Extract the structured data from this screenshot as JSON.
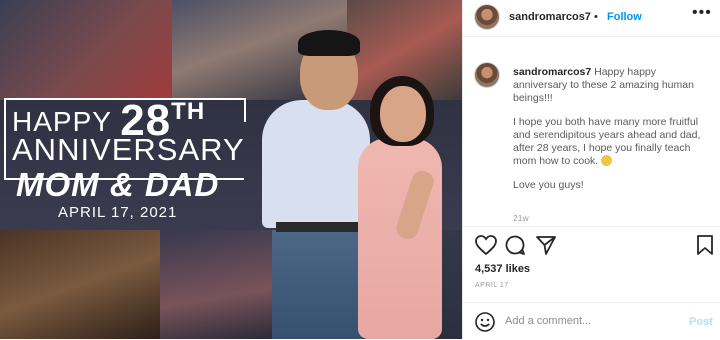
{
  "image": {
    "ann_happy": "HAPPY",
    "ann_number": "28",
    "ann_ordinal": "TH",
    "ann_anniversary": "ANNIVERSARY",
    "ann_names": "MOM & DAD",
    "ann_date": "APRIL 17, 2021"
  },
  "header": {
    "username": "sandromarcos7",
    "separator": "•",
    "follow_label": "Follow",
    "more_label": "•••"
  },
  "caption": {
    "username": "sandromarcos7",
    "text1": "Happy happy anniversary to these 2 amazing human beings!!!",
    "text2": "I hope you both have many more fruitful and serendipitous years ahead and dad, after 28 years, I hope you finally teach mom how to cook.",
    "text3": "Love you guys!",
    "emoji": "laughing-emoji",
    "time": "21w"
  },
  "actions": {
    "like_icon": "heart-icon",
    "comment_icon": "comment-icon",
    "share_icon": "share-icon",
    "save_icon": "bookmark-icon"
  },
  "likes": "4,537 likes",
  "post_date": "APRIL 17",
  "comment": {
    "placeholder": "Add a comment...",
    "post_label": "Post",
    "emoji_icon": "smiley-icon"
  }
}
